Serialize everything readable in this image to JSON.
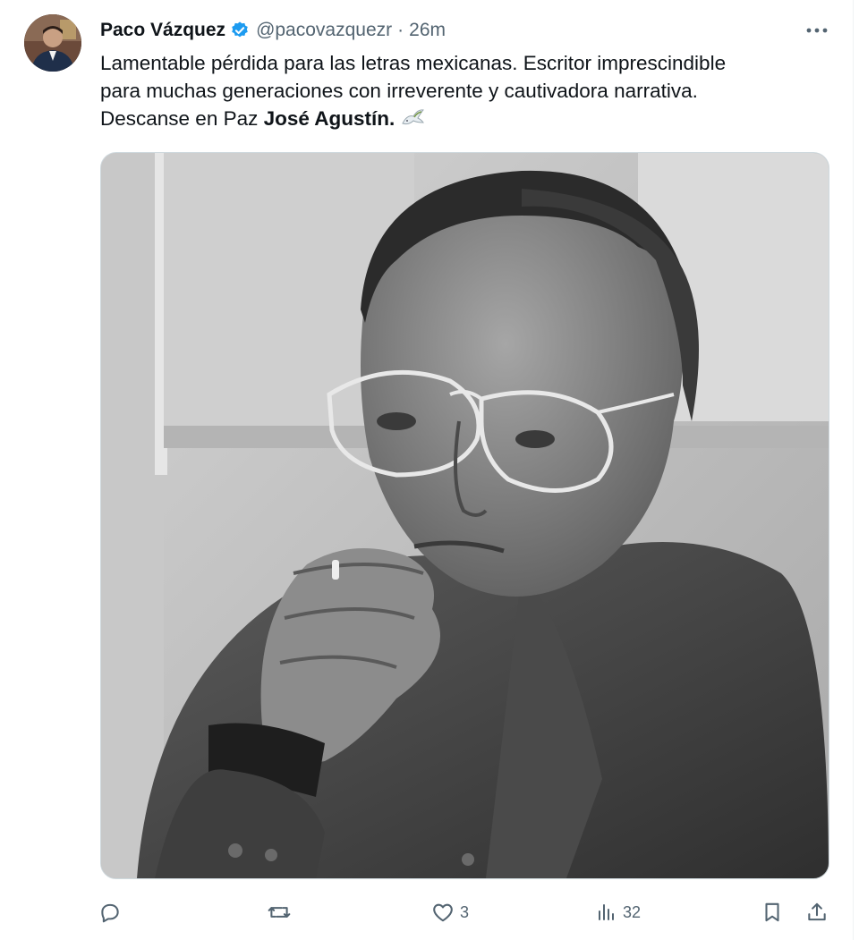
{
  "tweet": {
    "author": {
      "display_name": "Paco Vázquez",
      "handle": "@pacovazquezr",
      "separator": "·",
      "time": "26m",
      "verified": true
    },
    "text_lines": [
      "Lamentable pérdida para las letras mexicanas. Escritor imprescindible",
      "para muchas generaciones con irreverente y cautivadora narrativa."
    ],
    "text_line3_prefix": "Descanse en Paz ",
    "text_line3_bold": "José Agustín.",
    "emoji": "dove-emoji",
    "media": {
      "kind": "photo",
      "content": "black-and-white portrait photo"
    },
    "actions": {
      "reply_count": "",
      "retweet_count": "",
      "like_count": "3",
      "views_count": "32"
    }
  },
  "colors": {
    "text": "#0f1419",
    "secondary": "#536471",
    "verified_blue": "#1d9bf0",
    "border": "#cfd9de"
  },
  "icons": [
    "more-icon",
    "verified-badge-icon",
    "reply-icon",
    "retweet-icon",
    "like-icon",
    "views-icon",
    "bookmark-icon",
    "share-icon"
  ]
}
